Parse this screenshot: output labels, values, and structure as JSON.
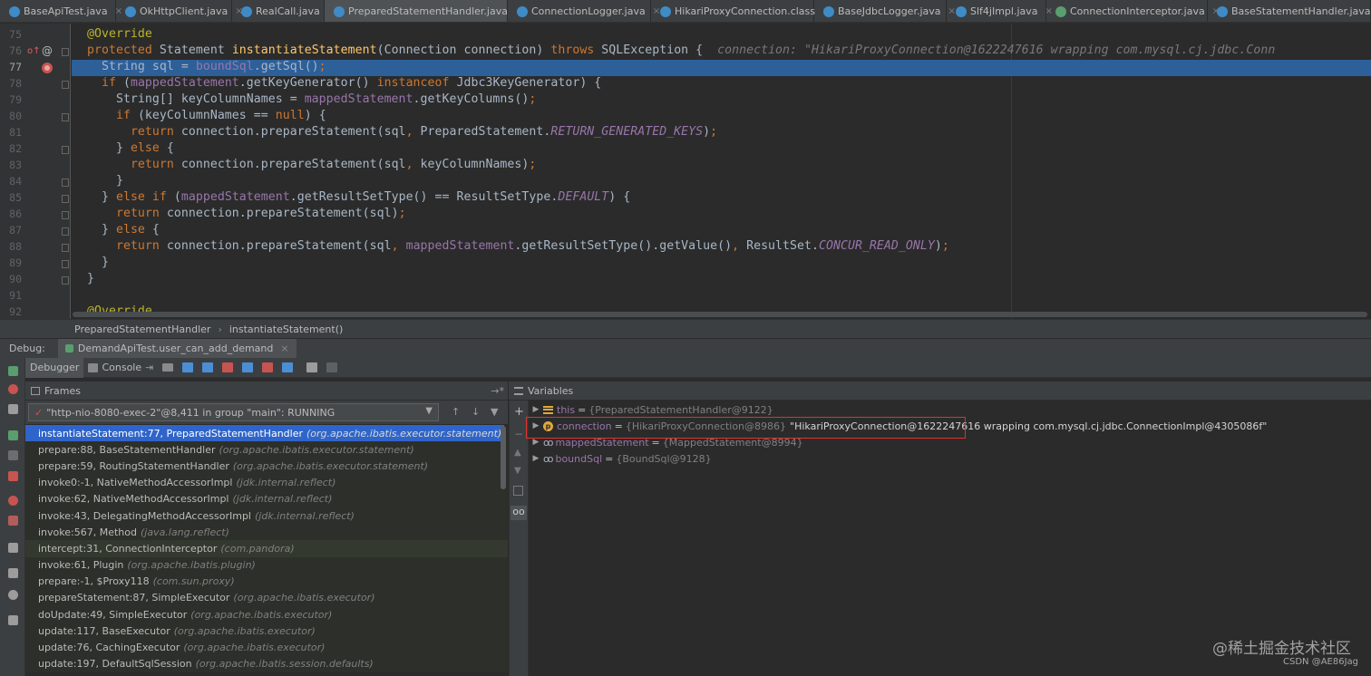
{
  "tabs": [
    {
      "label": "BaseApiTest.java",
      "width": 128,
      "icon": "cls",
      "active": false
    },
    {
      "label": "OkHttpClient.java",
      "width": 128,
      "icon": "cls",
      "active": false
    },
    {
      "label": "RealCall.java",
      "width": 102,
      "icon": "cls",
      "active": false
    },
    {
      "label": "PreparedStatementHandler.java",
      "width": 202,
      "icon": "cls",
      "active": true
    },
    {
      "label": "ConnectionLogger.java",
      "width": 158,
      "icon": "cls",
      "active": false
    },
    {
      "label": "HikariProxyConnection.class",
      "width": 180,
      "icon": "cls",
      "active": false
    },
    {
      "label": "BaseJdbcLogger.java",
      "width": 146,
      "icon": "cls",
      "active": false
    },
    {
      "label": "Slf4jImpl.java",
      "width": 110,
      "icon": "cls",
      "active": false
    },
    {
      "label": "ConnectionInterceptor.java",
      "width": 178,
      "icon": "iface",
      "active": false
    },
    {
      "label": "BaseStatementHandler.java",
      "width": 180,
      "icon": "cls",
      "active": false
    }
  ],
  "editor": {
    "line_numbers": [
      "75",
      "76",
      "77",
      "78",
      "79",
      "80",
      "81",
      "82",
      "83",
      "84",
      "85",
      "86",
      "87",
      "88",
      "89",
      "90",
      "91",
      "92"
    ],
    "current_line": "77",
    "inline_hint": "connection: \"HikariProxyConnection@1622247616 wrapping com.mysql.cj.jdbc.Conn"
  },
  "breadcrumb": [
    "PreparedStatementHandler",
    "instantiateStatement()"
  ],
  "debug": {
    "label": "Debug:",
    "session_tab": "DemandApiTest.user_can_add_demand",
    "toolbar_tabs": [
      "Debugger",
      "Console"
    ]
  },
  "frames": {
    "title": "Frames",
    "thread": "\"http-nio-8080-exec-2\"@8,411 in group \"main\": RUNNING",
    "items": [
      {
        "method": "instantiateStatement:77, PreparedStatementHandler",
        "pkg": "(org.apache.ibatis.executor.statement)",
        "kind": "sel"
      },
      {
        "method": "prepare:88, BaseStatementHandler",
        "pkg": "(org.apache.ibatis.executor.statement)",
        "kind": "lib"
      },
      {
        "method": "prepare:59, RoutingStatementHandler",
        "pkg": "(org.apache.ibatis.executor.statement)",
        "kind": "lib"
      },
      {
        "method": "invoke0:-1, NativeMethodAccessorImpl",
        "pkg": "(jdk.internal.reflect)",
        "kind": "lib"
      },
      {
        "method": "invoke:62, NativeMethodAccessorImpl",
        "pkg": "(jdk.internal.reflect)",
        "kind": "lib"
      },
      {
        "method": "invoke:43, DelegatingMethodAccessorImpl",
        "pkg": "(jdk.internal.reflect)",
        "kind": "lib"
      },
      {
        "method": "invoke:567, Method",
        "pkg": "(java.lang.reflect)",
        "kind": "lib"
      },
      {
        "method": "intercept:31, ConnectionInterceptor",
        "pkg": "(com.pandora)",
        "kind": "hl2"
      },
      {
        "method": "invoke:61, Plugin",
        "pkg": "(org.apache.ibatis.plugin)",
        "kind": "lib"
      },
      {
        "method": "prepare:-1, $Proxy118",
        "pkg": "(com.sun.proxy)",
        "kind": "lib"
      },
      {
        "method": "prepareStatement:87, SimpleExecutor",
        "pkg": "(org.apache.ibatis.executor)",
        "kind": "lib"
      },
      {
        "method": "doUpdate:49, SimpleExecutor",
        "pkg": "(org.apache.ibatis.executor)",
        "kind": "lib"
      },
      {
        "method": "update:117, BaseExecutor",
        "pkg": "(org.apache.ibatis.executor)",
        "kind": "lib"
      },
      {
        "method": "update:76, CachingExecutor",
        "pkg": "(org.apache.ibatis.executor)",
        "kind": "lib"
      },
      {
        "method": "update:197, DefaultSqlSession",
        "pkg": "(org.apache.ibatis.session.defaults)",
        "kind": "lib"
      }
    ]
  },
  "variables": {
    "title": "Variables",
    "items": [
      {
        "name": "this",
        "type": "{PreparedStatementHandler@9122}",
        "value": "",
        "icon": "bars"
      },
      {
        "name": "connection",
        "type": "{HikariProxyConnection@8986}",
        "value": "\"HikariProxyConnection@1622247616 wrapping com.mysql.cj.jdbc.ConnectionImpl@4305086f\"",
        "icon": "p"
      },
      {
        "name": "mappedStatement",
        "type": "{MappedStatement@8994}",
        "value": "",
        "icon": "oo"
      },
      {
        "name": "boundSql",
        "type": "{BoundSql@9128}",
        "value": "",
        "icon": "oo"
      }
    ]
  },
  "watermark": "@稀土掘金技术社区",
  "credit": "CSDN @AE86Jag",
  "colors": {
    "accent": "#2f65ca",
    "keyword": "#cc7832",
    "highlight": "#e0322d",
    "breakpoint": "#c75450"
  }
}
